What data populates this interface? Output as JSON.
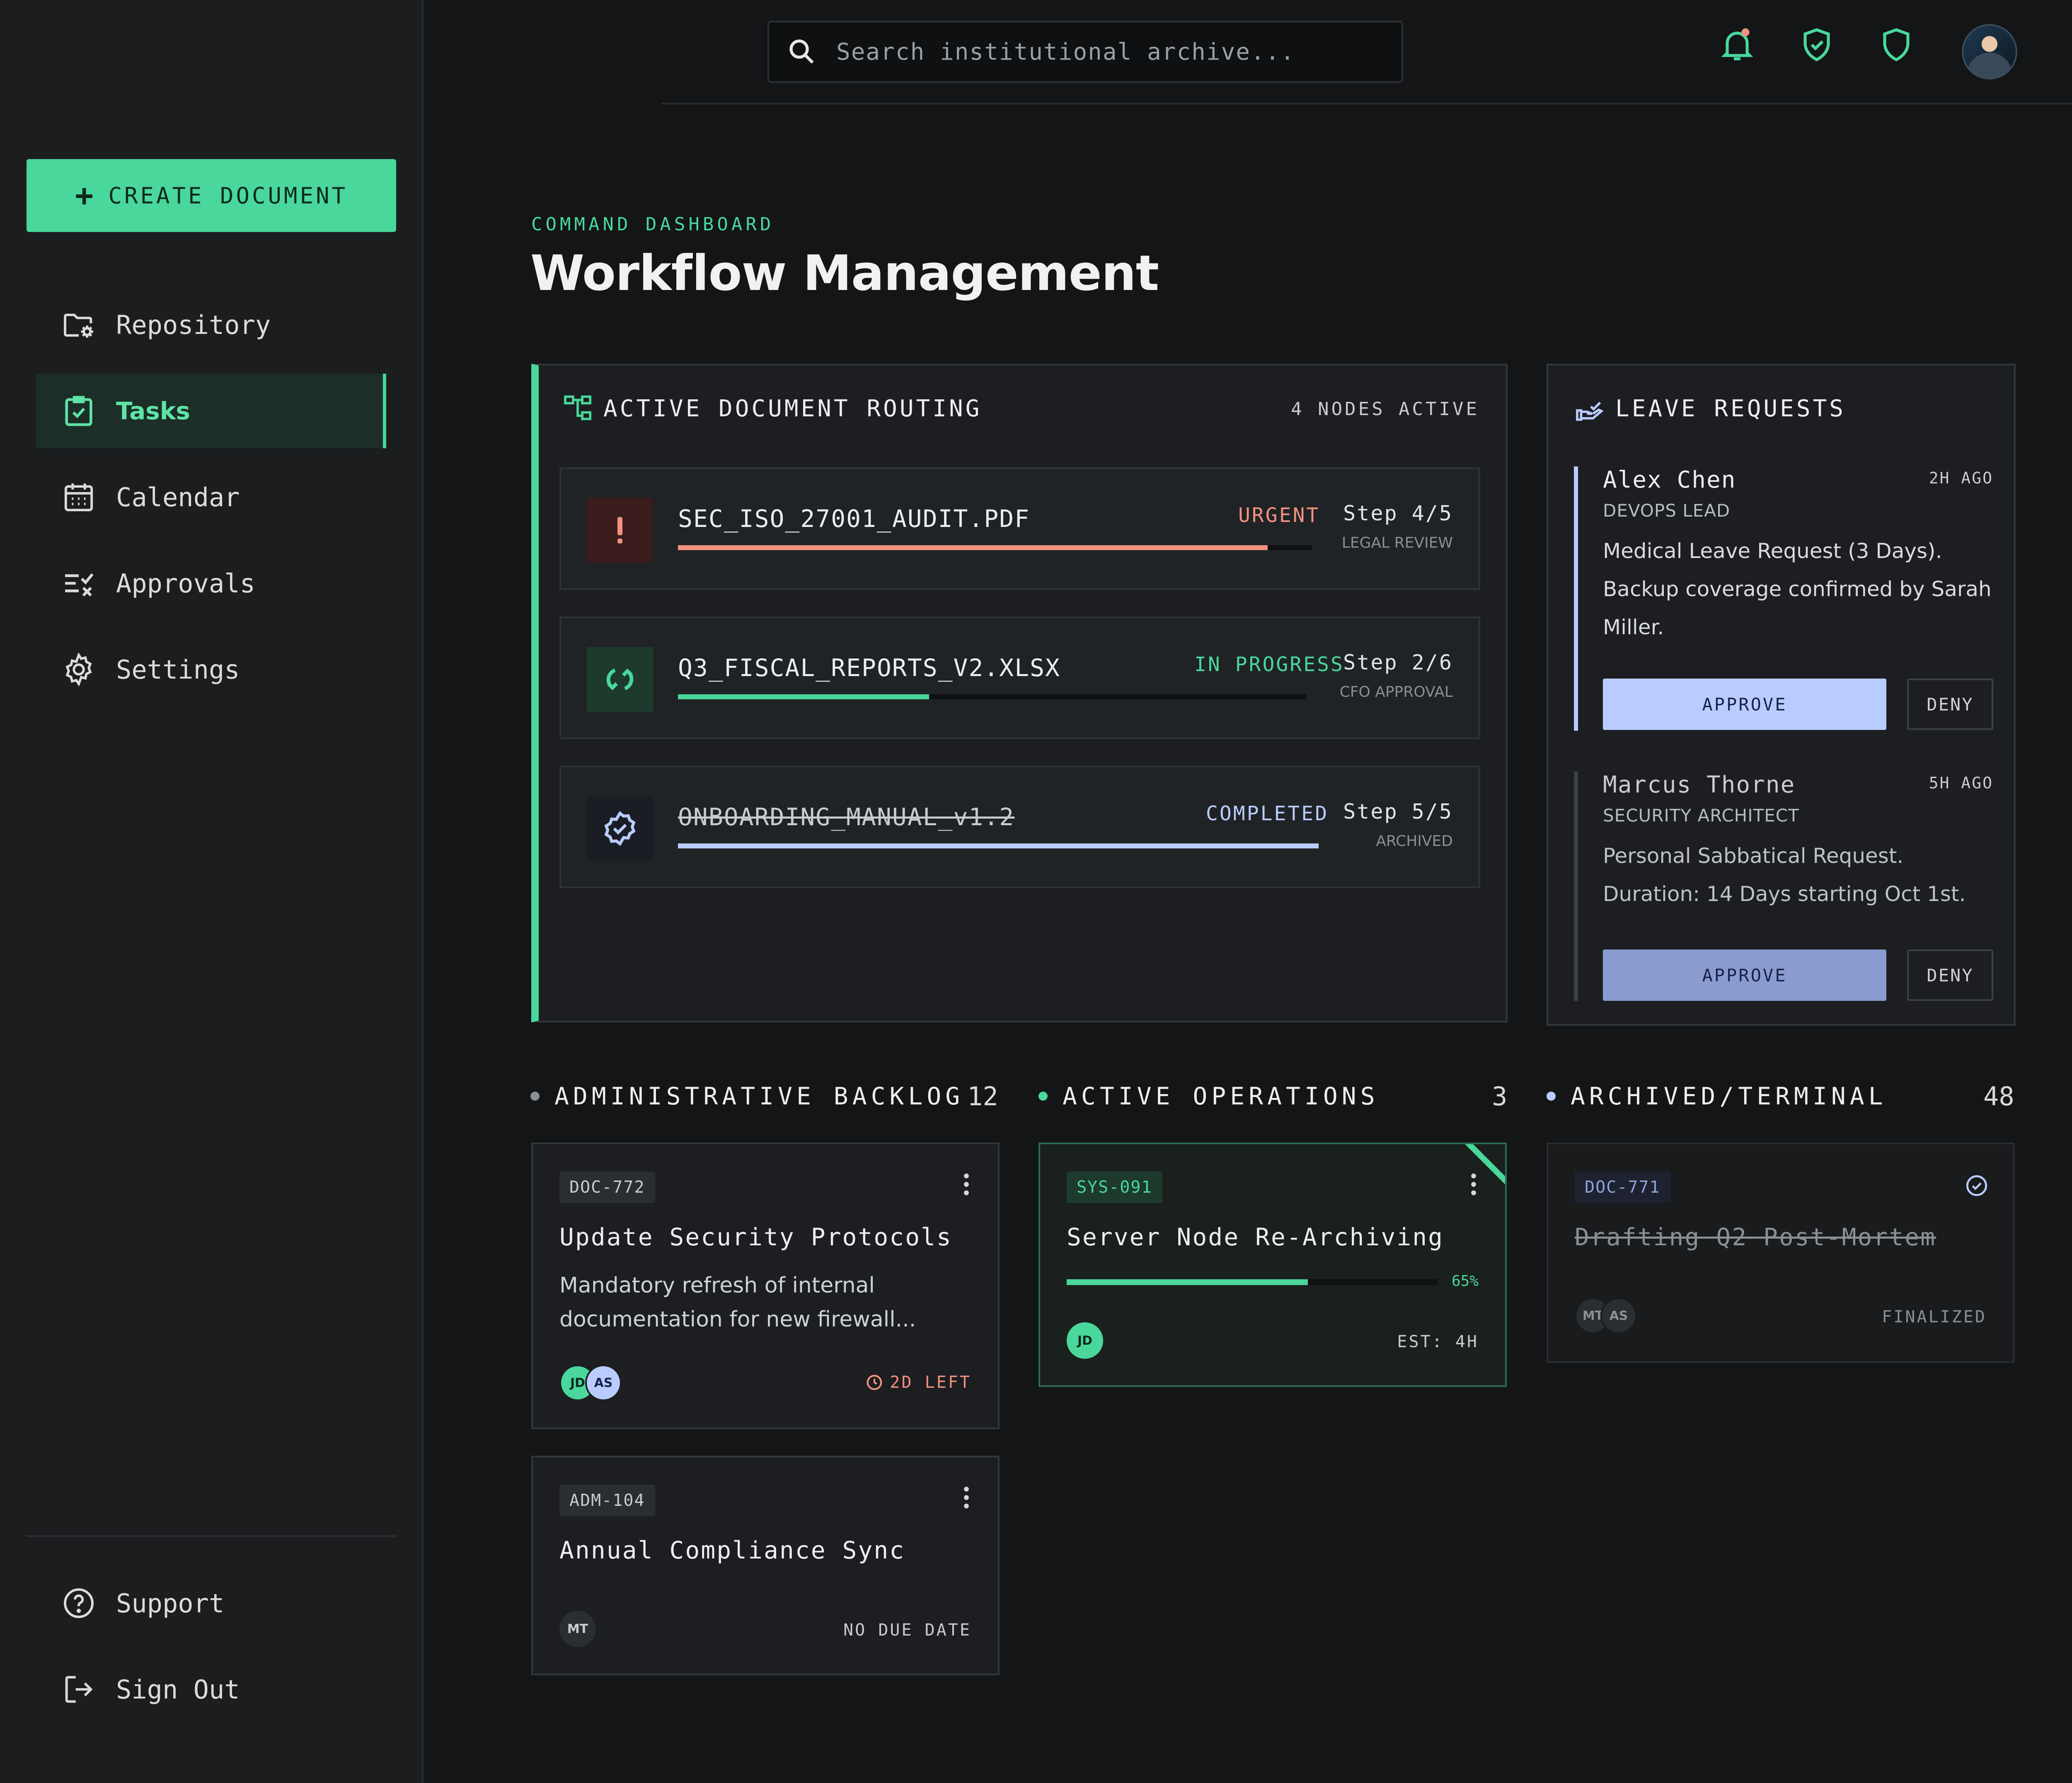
{
  "sidebar": {
    "create_label": "CREATE DOCUMENT",
    "items": [
      {
        "label": "Repository",
        "icon": "folder-gear-icon"
      },
      {
        "label": "Tasks",
        "icon": "clipboard-check-icon",
        "active": true
      },
      {
        "label": "Calendar",
        "icon": "calendar-icon"
      },
      {
        "label": "Approvals",
        "icon": "list-check-icon"
      },
      {
        "label": "Settings",
        "icon": "gear-icon"
      }
    ],
    "footer": [
      {
        "label": "Support",
        "icon": "help-circle-icon"
      },
      {
        "label": "Sign Out",
        "icon": "sign-out-icon"
      }
    ]
  },
  "topbar": {
    "search_placeholder": "Search institutional archive...",
    "icons": [
      "bell-icon",
      "shield-check-icon",
      "shield-icon",
      "avatar"
    ]
  },
  "header": {
    "eyebrow": "COMMAND DASHBOARD",
    "title": "Workflow Management"
  },
  "routing": {
    "title": "ACTIVE DOCUMENT ROUTING",
    "nodes_active": "4 NODES ACTIVE",
    "rows": [
      {
        "name": "SEC_ISO_27001_AUDIT.PDF",
        "status": "URGENT",
        "step": "Step 4/5",
        "sub": "LEGAL REVIEW",
        "progress": 0.93,
        "icon": "exclamation-icon"
      },
      {
        "name": "Q3_FISCAL_REPORTS_V2.XLSX",
        "status": "IN PROGRESS",
        "step": "Step 2/6",
        "sub": "CFO APPROVAL",
        "progress": 0.4,
        "icon": "sync-icon"
      },
      {
        "name": "ONBOARDING_MANUAL_v1.2",
        "status": "COMPLETED",
        "step": "Step 5/5",
        "sub": "ARCHIVED",
        "progress": 1.0,
        "icon": "verified-badge-icon"
      }
    ]
  },
  "leave": {
    "title": "LEAVE REQUESTS",
    "items": [
      {
        "name": "Alex Chen",
        "time": "2H AGO",
        "role": "DEVOPS LEAD",
        "desc": "Medical Leave Request (3 Days). Backup coverage confirmed by Sarah Miller.",
        "approve": "APPROVE",
        "deny": "DENY"
      },
      {
        "name": "Marcus Thorne",
        "time": "5H AGO",
        "role": "SECURITY ARCHITECT",
        "desc": "Personal Sabbatical Request. Duration: 14 Days starting Oct 1st.",
        "approve": "APPROVE",
        "deny": "DENY"
      }
    ]
  },
  "columns": [
    {
      "title": "ADMINISTRATIVE BACKLOG",
      "count": "12"
    },
    {
      "title": "ACTIVE OPERATIONS",
      "count": "3"
    },
    {
      "title": "ARCHIVED/TERMINAL",
      "count": "48"
    }
  ],
  "cards": {
    "doc772": {
      "tag": "DOC-772",
      "title": "Update Security Protocols",
      "desc": "Mandatory refresh of internal documentation for new firewall...",
      "avatars": [
        "JD",
        "AS"
      ],
      "meta": "2D LEFT"
    },
    "adm104": {
      "tag": "ADM-104",
      "title": "Annual Compliance Sync",
      "avatars": [
        "MT"
      ],
      "meta": "NO DUE DATE"
    },
    "sys091": {
      "tag": "SYS-091",
      "title": "Server Node Re-Archiving",
      "progress_label": "65%",
      "progress": 0.65,
      "avatars": [
        "JD"
      ],
      "meta": "EST: 4H"
    },
    "doc771": {
      "tag": "DOC-771",
      "title": "Drafting Q2 Post-Mortem",
      "avatars": [
        "MT",
        "AS"
      ],
      "meta": "FINALIZED"
    }
  },
  "colors": {
    "accent": "#49d79b",
    "urgent": "#f2917f",
    "periwinkle": "#b9ccff",
    "background": "#131516",
    "panel": "#1c1e21"
  }
}
